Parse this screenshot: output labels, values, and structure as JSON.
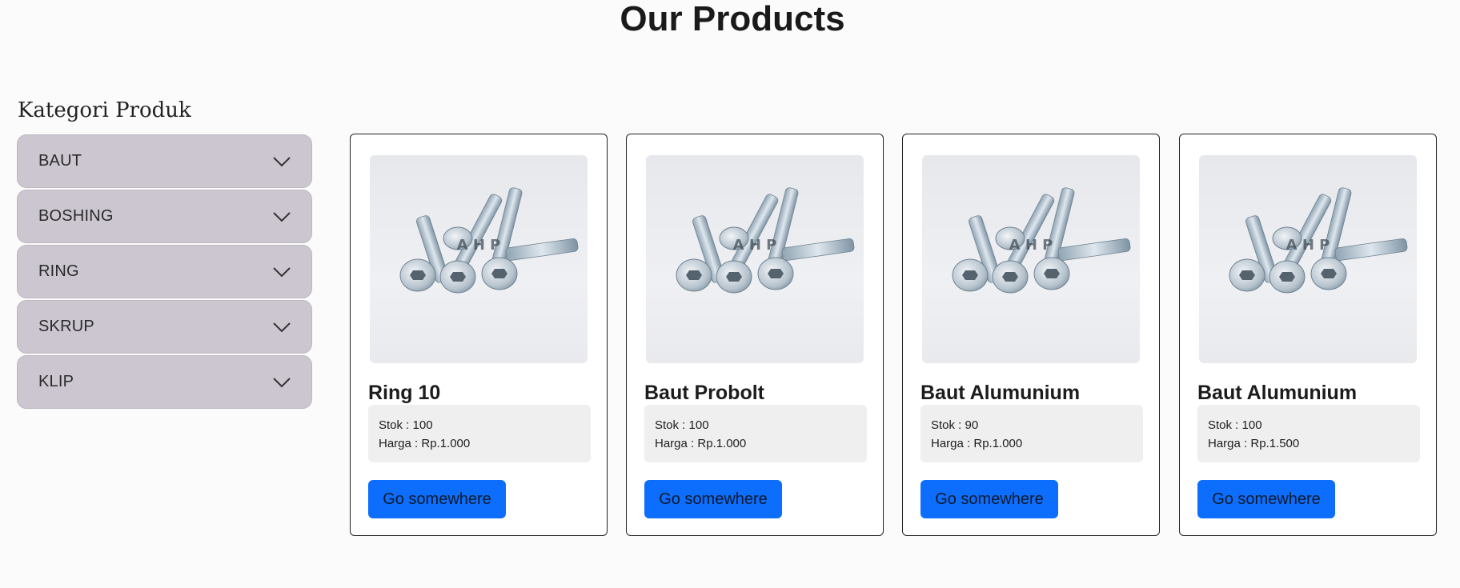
{
  "page": {
    "title": "Our Products"
  },
  "sidebar": {
    "title": "Kategori Produk",
    "categories": [
      {
        "label": "BAUT"
      },
      {
        "label": "BOSHING"
      },
      {
        "label": "RING"
      },
      {
        "label": "SKRUP"
      },
      {
        "label": "KLIP"
      }
    ]
  },
  "products": [
    {
      "name": "Ring 10",
      "stock": "Stok : 100",
      "price": "Harga : Rp.1.000",
      "button": "Go somewhere",
      "image_watermark": "A H P"
    },
    {
      "name": "Baut Probolt",
      "stock": "Stok : 100",
      "price": "Harga : Rp.1.000",
      "button": "Go somewhere",
      "image_watermark": "A H P"
    },
    {
      "name": "Baut Alumunium",
      "stock": "Stok : 90",
      "price": "Harga : Rp.1.000",
      "button": "Go somewhere",
      "image_watermark": "A H P"
    },
    {
      "name": "Baut Alumunium",
      "stock": "Stok : 100",
      "price": "Harga : Rp.1.500",
      "button": "Go somewhere",
      "image_watermark": "A H P"
    }
  ],
  "colors": {
    "accent": "#0d6efd",
    "accordion_bg": "#cbc6d0",
    "info_bg": "#efefef"
  },
  "icons": {
    "accordion": "chevron-down-icon"
  }
}
